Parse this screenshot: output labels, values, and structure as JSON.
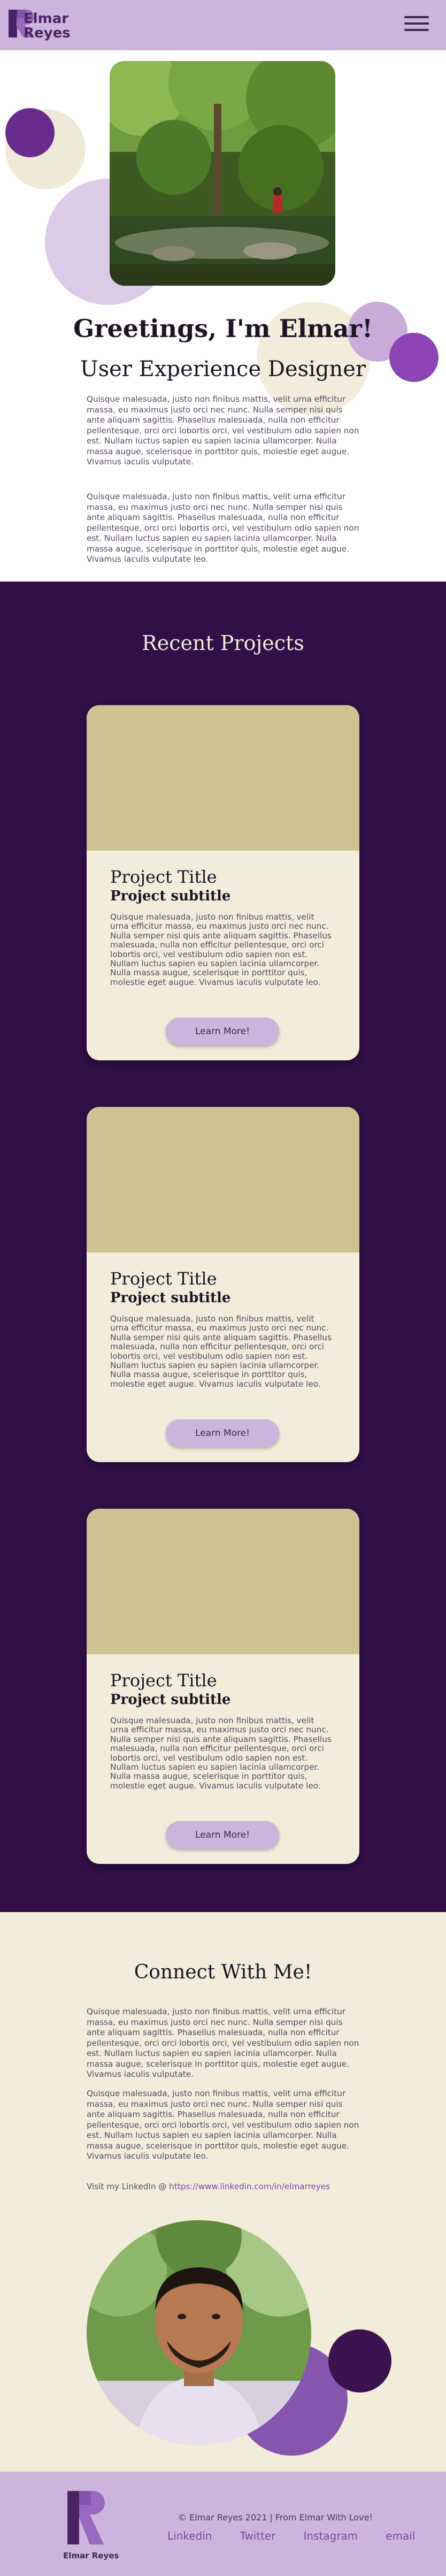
{
  "header": {
    "brand_line1": "Elmar",
    "brand_line2": "Reyes",
    "menu_icon": "hamburger-menu-icon"
  },
  "hero": {
    "greeting": "Greetings, I'm Elmar!",
    "role": "User Experience Designer",
    "paragraph1": "Quisque malesuada, justo non finibus mattis, velit urna efficitur massa, eu maximus justo orci nec nunc. Nulla semper nisi quis ante aliquam sagittis. Phasellus malesuada, nulla non efficitur pellentesque, orci orci lobortis orci, vel vestibulum odio sapien non est. Nullam luctus sapien eu sapien lacinia ullamcorper. Nulla massa augue, scelerisque in porttitor quis, molestie eget augue. Vivamus iaculis vulputate.",
    "paragraph2": "Quisque malesuada, justo non finibus mattis, velit urna efficitur massa, eu maximus justo orci nec nunc. Nulla semper nisi quis ante aliquam sagittis. Phasellus malesuada, nulla non efficitur pellentesque, orci orci lobortis orci, vel vestibulum odio sapien non est. Nullam luctus sapien eu sapien lacinia ullamcorper. Nulla massa augue, scelerisque in porttitor quis, molestie eget augue. Vivamus iaculis vulputate leo."
  },
  "projects": {
    "heading": "Recent Projects",
    "items": [
      {
        "title": "Project Title",
        "subtitle": "Project subtitle",
        "description": "Quisque malesuada, justo non finibus mattis, velit urna efficitur massa, eu maximus justo orci nec nunc. Nulla semper nisi quis ante aliquam sagittis. Phasellus malesuada, nulla non efficitur pellentesque, orci orci lobortis orci, vel vestibulum odio sapien non est. Nullam luctus sapien eu sapien lacinia ullamcorper. Nulla massa augue, scelerisque in porttitor quis, molestie eget augue. Vivamus iaculis vulputate leo.",
        "button": "Learn More!"
      },
      {
        "title": "Project Title",
        "subtitle": "Project subtitle",
        "description": "Quisque malesuada, justo non finibus mattis, velit urna efficitur massa, eu maximus justo orci nec nunc. Nulla semper nisi quis ante aliquam sagittis. Phasellus malesuada, nulla non efficitur pellentesque, orci orci lobortis orci, vel vestibulum odio sapien non est. Nullam luctus sapien eu sapien lacinia ullamcorper. Nulla massa augue, scelerisque in porttitor quis, molestie eget augue. Vivamus iaculis vulputate leo.",
        "button": "Learn More!"
      },
      {
        "title": "Project Title",
        "subtitle": "Project subtitle",
        "description": "Quisque malesuada, justo non finibus mattis, velit urna efficitur massa, eu maximus justo orci nec nunc. Nulla semper nisi quis ante aliquam sagittis. Phasellus malesuada, nulla non efficitur pellentesque, orci orci lobortis orci, vel vestibulum odio sapien non est. Nullam luctus sapien eu sapien lacinia ullamcorper. Nulla massa augue, scelerisque in porttitor quis, molestie eget augue. Vivamus iaculis vulputate leo.",
        "button": "Learn More!"
      }
    ]
  },
  "connect": {
    "heading": "Connect With Me!",
    "paragraph1": "Quisque malesuada, justo non finibus mattis, velit urna efficitur massa, eu maximus justo orci nec nunc. Nulla semper nisi quis ante aliquam sagittis. Phasellus malesuada, nulla non efficitur pellentesque, orci orci lobortis orci, vel vestibulum odio sapien non est. Nullam luctus sapien eu sapien lacinia ullamcorper. Nulla massa augue, scelerisque in porttitor quis, molestie eget augue. Vivamus iaculis vulputate.",
    "paragraph2": "Quisque malesuada, justo non finibus mattis, velit urna efficitur massa, eu maximus justo orci nec nunc. Nulla semper nisi quis ante aliquam sagittis. Phasellus malesuada, nulla non efficitur pellentesque, orci orci lobortis orci, vel vestibulum odio sapien non est. Nullam luctus sapien eu sapien lacinia ullamcorper. Nulla massa augue, scelerisque in porttitor quis, molestie eget augue. Vivamus iaculis vulputate leo.",
    "visit_prefix": "Visit my LinkedIn @ ",
    "linkedin_url": "https://www.linkedin.com/in/elmarreyes"
  },
  "footer": {
    "brand": "Elmar Reyes",
    "copyright": "© Elmar Reyes 2021 | From Elmar With Love!",
    "links": [
      "Linkedin",
      "Twitter",
      "Instagram",
      "email"
    ]
  },
  "colors": {
    "lavender": "#cdb4dc",
    "deep_purple": "#310f47",
    "cream": "#f2ecdb",
    "khaki": "#cec292",
    "violet": "#7a4ba0"
  }
}
